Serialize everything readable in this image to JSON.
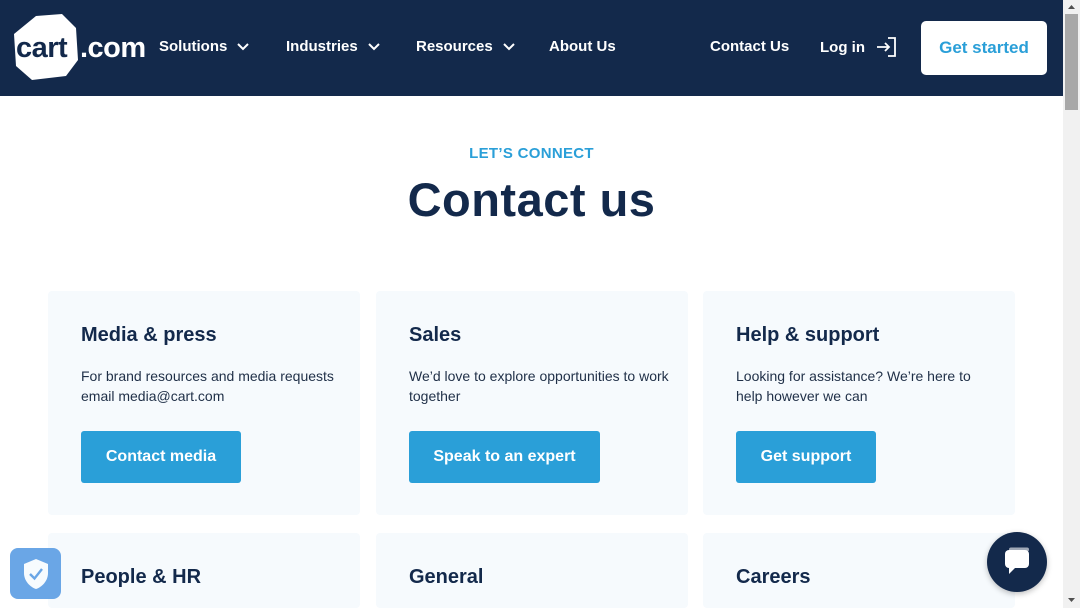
{
  "brand": {
    "logo_main": "cart",
    "logo_suffix": ".com"
  },
  "nav": {
    "solutions": "Solutions",
    "industries": "Industries",
    "resources": "Resources",
    "about": "About Us",
    "contact": "Contact Us",
    "login": "Log in",
    "get_started": "Get started"
  },
  "hero": {
    "eyebrow": "LET’S CONNECT",
    "title": "Contact us"
  },
  "cards": [
    {
      "title": "Media & press",
      "desc": "For brand resources and media requests email media@cart.com",
      "button": "Contact media"
    },
    {
      "title": "Sales",
      "desc": "We’d love to explore opportunities to work together",
      "button": "Speak to an expert"
    },
    {
      "title": "Help & support",
      "desc": "Looking for assistance? We’re here to help however we can",
      "button": "Get support"
    },
    {
      "title": "People & HR"
    },
    {
      "title": "General"
    },
    {
      "title": "Careers"
    }
  ],
  "colors": {
    "navy": "#13294b",
    "accent": "#2a9fd8",
    "card_bg": "#f6fafd"
  },
  "icons": [
    "chevron-down-icon",
    "login-arrow-icon",
    "shield-check-icon",
    "chat-icon"
  ]
}
